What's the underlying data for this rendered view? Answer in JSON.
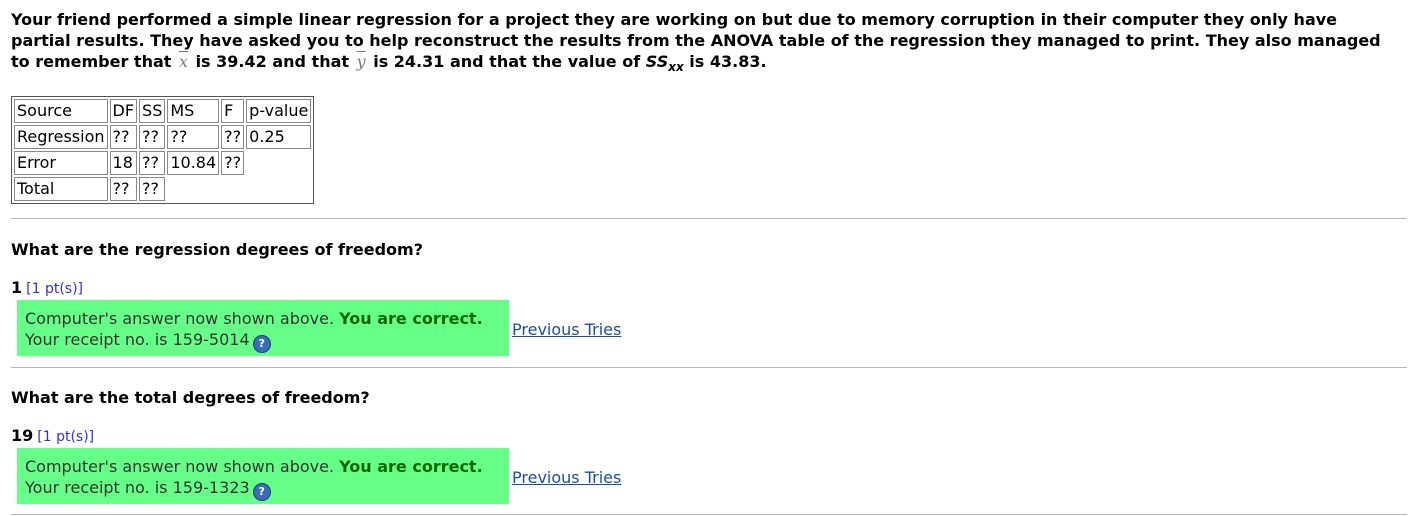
{
  "intro": {
    "part1": "Your friend performed a simple linear regression for a project they are working on but due to memory corruption in their computer they only have partial results. They have asked you to help reconstruct the results from the ANOVA table of the regression they managed to print. They also managed to remember that ",
    "xbar_symbol": "x",
    "part2": " is 39.42 and that ",
    "ybar_symbol": "y",
    "part3": " is 24.31 and that the value of ",
    "ss_label": "SS",
    "ss_sub": "xx",
    "part4": " is 43.83."
  },
  "anova": {
    "headers": [
      "Source",
      "DF",
      "SS",
      "MS",
      "F",
      "p-value"
    ],
    "rows": [
      [
        "Regression",
        "??",
        "??",
        "??",
        "??",
        "0.25"
      ],
      [
        "Error",
        "18",
        "??",
        "10.84",
        "??",
        ""
      ],
      [
        "Total",
        "??",
        "??",
        "",
        "",
        ""
      ]
    ]
  },
  "questions": [
    {
      "prompt": "What are the regression degrees of freedom?",
      "answer": "1",
      "points": "[1 pt(s)]",
      "feedback_text": "Computer's answer now shown above. ",
      "feedback_status": "You are correct.",
      "receipt": "Your receipt no. is 159-5014",
      "help_icon": "?",
      "previous_tries": "Previous Tries"
    },
    {
      "prompt": "What are the total degrees of freedom?",
      "answer": "19",
      "points": "[1 pt(s)]",
      "feedback_text": "Computer's answer now shown above. ",
      "feedback_status": "You are correct.",
      "receipt": "Your receipt no. is 159-1323",
      "help_icon": "?",
      "previous_tries": "Previous Tries"
    }
  ],
  "colors": {
    "feedback_bg": "#66ff88",
    "correct_text": "#006600",
    "link": "#1d4fa0",
    "points": "#3333cc"
  }
}
